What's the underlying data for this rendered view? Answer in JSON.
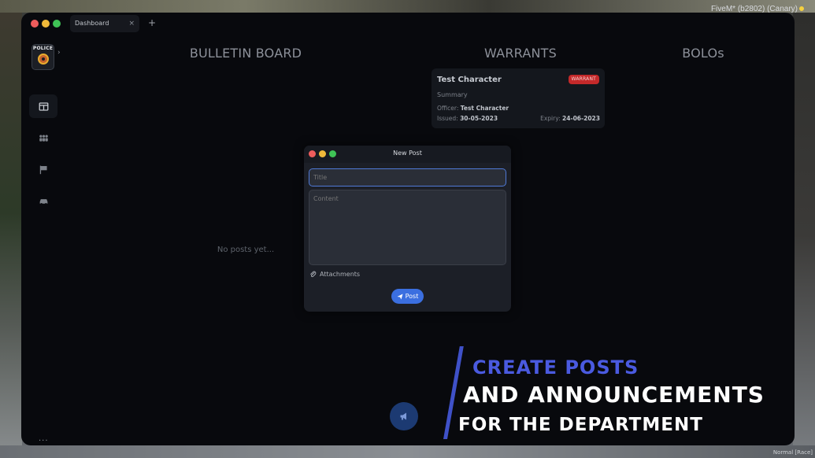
{
  "overlay": {
    "fivem_label": "FiveM* (b2802) (Canary)"
  },
  "window": {
    "tab": {
      "label": "Dashboard",
      "close": "×"
    },
    "tab_add": "+"
  },
  "sidebar": {
    "logo_text": "POLICE",
    "toggle": "›",
    "items": [
      {
        "icon": "dashboard-icon",
        "active": true
      },
      {
        "icon": "people-icon",
        "active": false
      },
      {
        "icon": "flag-icon",
        "active": false
      },
      {
        "icon": "car-icon",
        "active": false
      }
    ],
    "more": "..."
  },
  "board": {
    "bulletin_title": "BULLETIN BOARD",
    "warrants_title": "WARRANTS",
    "bolos_title": "BOLOs",
    "no_posts": "No posts yet..."
  },
  "warrant_card": {
    "name": "Test Character",
    "badge": "WARRANT",
    "summary": "Summary",
    "officer_label": "Officer:",
    "officer_name": "Test Character",
    "issued_label": "Issued:",
    "issued_date": "30-05-2023",
    "expiry_label": "Expiry:",
    "expiry_date": "24-06-2023"
  },
  "new_post_modal": {
    "title": "New Post",
    "title_placeholder": "Title",
    "content_placeholder": "Content",
    "attachments_label": "Attachments",
    "post_button": "Post"
  },
  "promo": {
    "line1": "CREATE POSTS",
    "line2": "AND ANNOUNCEMENTS",
    "line3": "FOR THE DEPARTMENT"
  },
  "colors": {
    "accent_blue": "#3b6fe0",
    "warrant_red": "#c4292a",
    "promo_blue": "#4a5ae0"
  },
  "corner_tag": "Normal [Race]"
}
